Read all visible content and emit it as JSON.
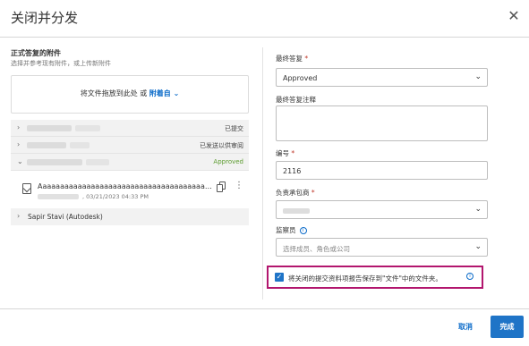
{
  "dialog": {
    "title": "关闭并分发"
  },
  "left": {
    "attachments_title": "正式答复的附件",
    "attachments_sub": "选择并参考现有附件，或上传新附件",
    "dropzone_text": "将文件拖放到此处 或",
    "dropzone_link": "附着自",
    "rows": [
      {
        "status": "已提交"
      },
      {
        "status": "已发送以供审阅"
      },
      {
        "status": "Approved"
      }
    ],
    "file": {
      "name": "Aaaaaaaaaaaaaaaaaaaaaaaaaaaaaaaaaaaaaaaaaa...",
      "meta": ", 03/21/2023 04:33 PM"
    },
    "reviewer": "Sapir Stavi (Autodesk)"
  },
  "right": {
    "final_answer_label": "最终答复",
    "final_answer_value": "Approved",
    "final_note_label": "最终答复注释",
    "number_label": "编号",
    "number_value": "2116",
    "contractor_label": "负责承包商",
    "supervisor_label": "监察员",
    "supervisor_placeholder": "选择成员、角色或公司",
    "checkbox_label": "将关闭的提交资料项报告保存到\"文件\"中的文件夹。"
  },
  "footer": {
    "cancel": "取消",
    "done": "完成"
  }
}
